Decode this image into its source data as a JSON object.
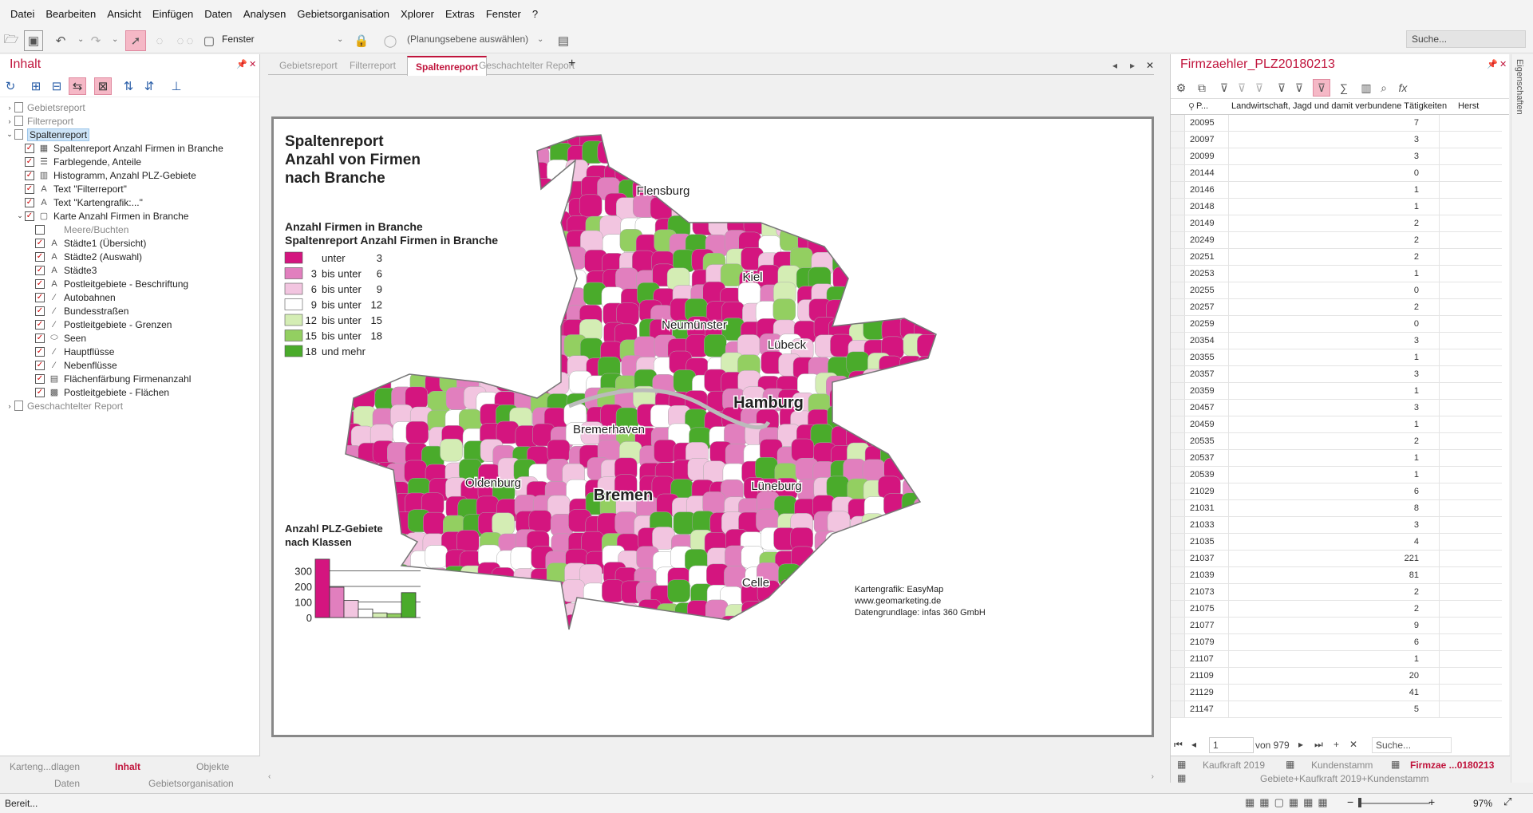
{
  "menu": [
    "Datei",
    "Bearbeiten",
    "Ansicht",
    "Einfügen",
    "Daten",
    "Analysen",
    "Gebietsorganisation",
    "Xplorer",
    "Extras",
    "Fenster",
    "?"
  ],
  "toolbar": {
    "window_label": "Fenster",
    "planning_label": "(Planungsebene auswählen)",
    "search_placeholder": "Suche..."
  },
  "left_panel": {
    "title": "Inhalt",
    "tree": [
      {
        "label": "Gebietsreport",
        "level": 0,
        "arrow": "›",
        "kind": "doc",
        "grey": true
      },
      {
        "label": "Filterreport",
        "level": 0,
        "arrow": "›",
        "kind": "doc",
        "grey": true
      },
      {
        "label": "Spaltenreport",
        "level": 0,
        "arrow": "⌄",
        "kind": "doc",
        "sel": true
      },
      {
        "label": "Spaltenreport Anzahl Firmen in Branche",
        "level": 1,
        "cb": true,
        "icon": "▦"
      },
      {
        "label": "Farblegende, Anteile",
        "level": 1,
        "cb": true,
        "icon": "☰"
      },
      {
        "label": "Histogramm, Anzahl PLZ-Gebiete",
        "level": 1,
        "cb": true,
        "icon": "▥"
      },
      {
        "label": "Text \"Filterreport\"",
        "level": 1,
        "cb": true,
        "icon": "A"
      },
      {
        "label": "Text \"Kartengrafik:...\"",
        "level": 1,
        "cb": true,
        "icon": "A"
      },
      {
        "label": "Karte Anzahl Firmen in Branche",
        "level": 1,
        "arrow": "⌄",
        "cb": true,
        "icon": "▢"
      },
      {
        "label": "Meere/Buchten",
        "level": 2,
        "cb": false,
        "icon": "",
        "grey": true
      },
      {
        "label": "Städte1 (Übersicht)",
        "level": 2,
        "cb": true,
        "icon": "A"
      },
      {
        "label": "Städte2 (Auswahl)",
        "level": 2,
        "cb": true,
        "icon": "A"
      },
      {
        "label": "Städte3",
        "level": 2,
        "cb": true,
        "icon": "A"
      },
      {
        "label": "Postleitgebiete - Beschriftung",
        "level": 2,
        "cb": true,
        "icon": "A"
      },
      {
        "label": "Autobahnen",
        "level": 2,
        "cb": true,
        "icon": "⁄"
      },
      {
        "label": "Bundesstraßen",
        "level": 2,
        "cb": true,
        "icon": "⁄"
      },
      {
        "label": "Postleitgebiete - Grenzen",
        "level": 2,
        "cb": true,
        "icon": "⁄"
      },
      {
        "label": "Seen",
        "level": 2,
        "cb": true,
        "icon": "⬭"
      },
      {
        "label": "Hauptflüsse",
        "level": 2,
        "cb": true,
        "icon": "⁄"
      },
      {
        "label": "Nebenflüsse",
        "level": 2,
        "cb": true,
        "icon": "⁄"
      },
      {
        "label": "Flächenfärbung Firmenanzahl",
        "level": 2,
        "cb": true,
        "icon": "▤"
      },
      {
        "label": "Postleitgebiete - Flächen",
        "level": 2,
        "cb": true,
        "icon": "▩"
      },
      {
        "label": "Geschachtelter Report",
        "level": 0,
        "arrow": "›",
        "kind": "doc",
        "grey": true
      }
    ],
    "bottom_tabs_row1": [
      "Karteng...dlagen",
      "Inhalt",
      "Objekte"
    ],
    "bottom_tabs_row2": [
      "Daten",
      "Gebietsorganisation"
    ]
  },
  "tabs": [
    "Gebietsreport",
    "Filterreport",
    "Spaltenreport",
    "Geschachtelter Report"
  ],
  "map": {
    "title_lines": [
      "Spaltenreport",
      "Anzahl von Firmen",
      "nach Branche"
    ],
    "legend_title_lines": [
      "Anzahl Firmen in Branche",
      "Spaltenreport Anzahl Firmen in Branche"
    ],
    "legend": [
      {
        "from": "",
        "sep": "unter",
        "to": "3",
        "color": "#d4157f"
      },
      {
        "from": "3",
        "sep": "bis unter",
        "to": "6",
        "color": "#e17fbe"
      },
      {
        "from": "6",
        "sep": "bis unter",
        "to": "9",
        "color": "#f2c5e0"
      },
      {
        "from": "9",
        "sep": "bis unter",
        "to": "12",
        "color": "#ffffff"
      },
      {
        "from": "12",
        "sep": "bis unter",
        "to": "15",
        "color": "#d4edb4"
      },
      {
        "from": "15",
        "sep": "bis unter",
        "to": "18",
        "color": "#93cf61"
      },
      {
        "from": "18",
        "sep": "und mehr",
        "to": "",
        "color": "#4aab2b"
      }
    ],
    "cities": [
      {
        "name": "Flensburg",
        "bold": false
      },
      {
        "name": "Kiel",
        "bold": false
      },
      {
        "name": "Neumünster",
        "bold": false
      },
      {
        "name": "Lübeck",
        "bold": false
      },
      {
        "name": "Hamburg",
        "bold": true
      },
      {
        "name": "Bremerhaven",
        "bold": false
      },
      {
        "name": "Oldenburg",
        "bold": false
      },
      {
        "name": "Bremen",
        "bold": true
      },
      {
        "name": "Lüneburg",
        "bold": false
      },
      {
        "name": "Celle",
        "bold": false
      }
    ],
    "hist_title_lines": [
      "Anzahl PLZ-Gebiete",
      "nach Klassen"
    ],
    "credits": [
      "Kartengrafik: EasyMap",
      "www.geomarketing.de",
      "Datengrundlage: infas 360 GmbH"
    ]
  },
  "chart_data": {
    "type": "bar",
    "title": "Anzahl PLZ-Gebiete nach Klassen",
    "categories": [
      "unter 3",
      "3 bis unter 6",
      "6 bis unter 9",
      "9 bis unter 12",
      "12 bis unter 15",
      "15 bis unter 18",
      "18 und mehr"
    ],
    "values": [
      375,
      195,
      110,
      55,
      30,
      25,
      160
    ],
    "colors": [
      "#d4157f",
      "#e17fbe",
      "#f2c5e0",
      "#ffffff",
      "#d4edb4",
      "#93cf61",
      "#4aab2b"
    ],
    "yticks": [
      "300",
      "200",
      "100",
      "0"
    ],
    "ylim": [
      0,
      400
    ]
  },
  "right_panel": {
    "title": "Firmzaehler_PLZ20180213",
    "col_plz": "P...",
    "col_main": "Landwirtschaft, Jagd und damit verbundene Tätigkeiten",
    "col_next": "Herst",
    "rows": [
      [
        "20095",
        "7"
      ],
      [
        "20097",
        "3"
      ],
      [
        "20099",
        "3"
      ],
      [
        "20144",
        "0"
      ],
      [
        "20146",
        "1"
      ],
      [
        "20148",
        "1"
      ],
      [
        "20149",
        "2"
      ],
      [
        "20249",
        "2"
      ],
      [
        "20251",
        "2"
      ],
      [
        "20253",
        "1"
      ],
      [
        "20255",
        "0"
      ],
      [
        "20257",
        "2"
      ],
      [
        "20259",
        "0"
      ],
      [
        "20354",
        "3"
      ],
      [
        "20355",
        "1"
      ],
      [
        "20357",
        "3"
      ],
      [
        "20359",
        "1"
      ],
      [
        "20457",
        "3"
      ],
      [
        "20459",
        "1"
      ],
      [
        "20535",
        "2"
      ],
      [
        "20537",
        "1"
      ],
      [
        "20539",
        "1"
      ],
      [
        "21029",
        "6"
      ],
      [
        "21031",
        "8"
      ],
      [
        "21033",
        "3"
      ],
      [
        "21035",
        "4"
      ],
      [
        "21037",
        "221"
      ],
      [
        "21039",
        "81"
      ],
      [
        "21073",
        "2"
      ],
      [
        "21075",
        "2"
      ],
      [
        "21077",
        "9"
      ],
      [
        "21079",
        "6"
      ],
      [
        "21107",
        "1"
      ],
      [
        "21109",
        "20"
      ],
      [
        "21129",
        "41"
      ],
      [
        "21147",
        "5"
      ]
    ],
    "nav_page": "1",
    "nav_of": "von 979",
    "nav_search": "Suche...",
    "bottom_tabs": [
      "Kaufkraft 2019",
      "Kundenstamm",
      "Firmzae ...0180213"
    ],
    "bottom_line": "Gebiete+Kaufkraft 2019+Kundenstamm",
    "side_label": "Eigenschaften"
  },
  "status": {
    "text": "Bereit...",
    "zoom": "97%"
  }
}
